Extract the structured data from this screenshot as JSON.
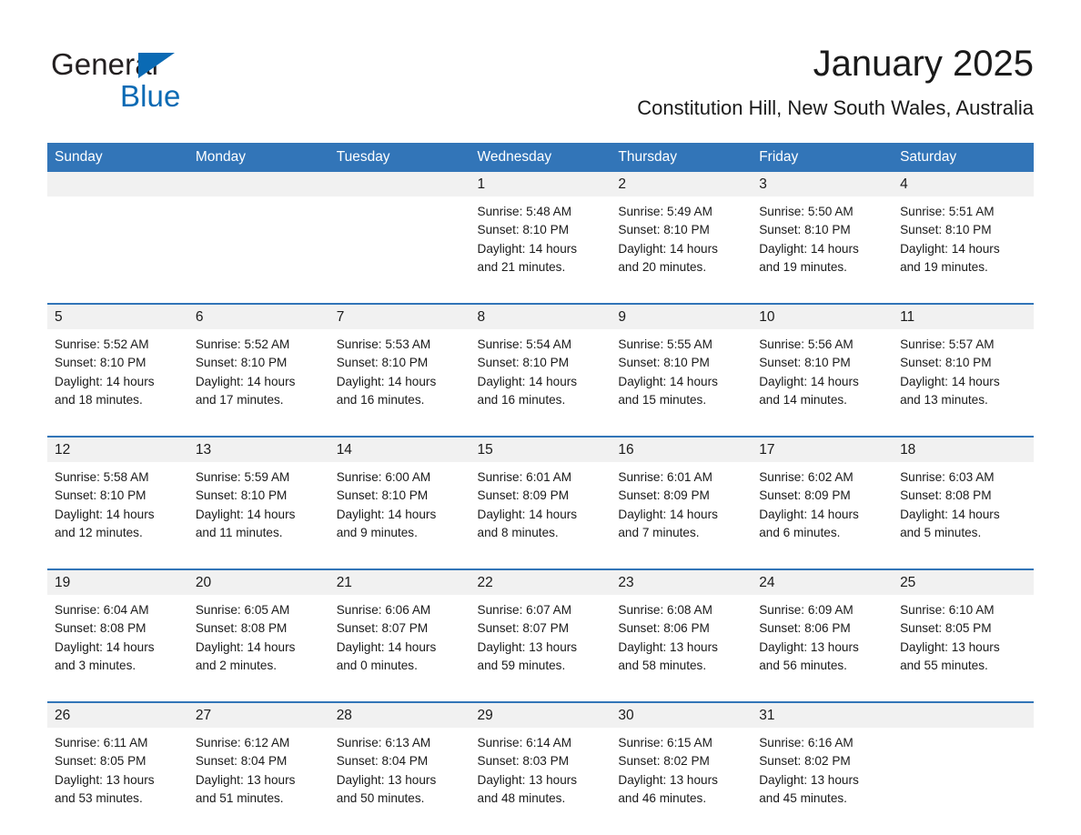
{
  "logo": {
    "text_dark": "General",
    "text_blue": "Blue",
    "triangle_color": "#0a6ab4"
  },
  "header": {
    "title": "January 2025",
    "subtitle": "Constitution Hill, New South Wales, Australia"
  },
  "theme": {
    "header_blue": "#3275b8",
    "row_divider_blue": "#3275b8",
    "daynum_band": "#f1f1f1",
    "text": "#1a1a1a"
  },
  "weekday_headers": [
    "Sunday",
    "Monday",
    "Tuesday",
    "Wednesday",
    "Thursday",
    "Friday",
    "Saturday"
  ],
  "weeks": [
    [
      {
        "day": "",
        "empty": true,
        "sunrise": "",
        "sunset": "",
        "daylight_line1": "",
        "daylight_line2": ""
      },
      {
        "day": "",
        "empty": true,
        "sunrise": "",
        "sunset": "",
        "daylight_line1": "",
        "daylight_line2": ""
      },
      {
        "day": "",
        "empty": true,
        "sunrise": "",
        "sunset": "",
        "daylight_line1": "",
        "daylight_line2": ""
      },
      {
        "day": "1",
        "empty": false,
        "sunrise": "Sunrise: 5:48 AM",
        "sunset": "Sunset: 8:10 PM",
        "daylight_line1": "Daylight: 14 hours",
        "daylight_line2": "and 21 minutes."
      },
      {
        "day": "2",
        "empty": false,
        "sunrise": "Sunrise: 5:49 AM",
        "sunset": "Sunset: 8:10 PM",
        "daylight_line1": "Daylight: 14 hours",
        "daylight_line2": "and 20 minutes."
      },
      {
        "day": "3",
        "empty": false,
        "sunrise": "Sunrise: 5:50 AM",
        "sunset": "Sunset: 8:10 PM",
        "daylight_line1": "Daylight: 14 hours",
        "daylight_line2": "and 19 minutes."
      },
      {
        "day": "4",
        "empty": false,
        "sunrise": "Sunrise: 5:51 AM",
        "sunset": "Sunset: 8:10 PM",
        "daylight_line1": "Daylight: 14 hours",
        "daylight_line2": "and 19 minutes."
      }
    ],
    [
      {
        "day": "5",
        "empty": false,
        "sunrise": "Sunrise: 5:52 AM",
        "sunset": "Sunset: 8:10 PM",
        "daylight_line1": "Daylight: 14 hours",
        "daylight_line2": "and 18 minutes."
      },
      {
        "day": "6",
        "empty": false,
        "sunrise": "Sunrise: 5:52 AM",
        "sunset": "Sunset: 8:10 PM",
        "daylight_line1": "Daylight: 14 hours",
        "daylight_line2": "and 17 minutes."
      },
      {
        "day": "7",
        "empty": false,
        "sunrise": "Sunrise: 5:53 AM",
        "sunset": "Sunset: 8:10 PM",
        "daylight_line1": "Daylight: 14 hours",
        "daylight_line2": "and 16 minutes."
      },
      {
        "day": "8",
        "empty": false,
        "sunrise": "Sunrise: 5:54 AM",
        "sunset": "Sunset: 8:10 PM",
        "daylight_line1": "Daylight: 14 hours",
        "daylight_line2": "and 16 minutes."
      },
      {
        "day": "9",
        "empty": false,
        "sunrise": "Sunrise: 5:55 AM",
        "sunset": "Sunset: 8:10 PM",
        "daylight_line1": "Daylight: 14 hours",
        "daylight_line2": "and 15 minutes."
      },
      {
        "day": "10",
        "empty": false,
        "sunrise": "Sunrise: 5:56 AM",
        "sunset": "Sunset: 8:10 PM",
        "daylight_line1": "Daylight: 14 hours",
        "daylight_line2": "and 14 minutes."
      },
      {
        "day": "11",
        "empty": false,
        "sunrise": "Sunrise: 5:57 AM",
        "sunset": "Sunset: 8:10 PM",
        "daylight_line1": "Daylight: 14 hours",
        "daylight_line2": "and 13 minutes."
      }
    ],
    [
      {
        "day": "12",
        "empty": false,
        "sunrise": "Sunrise: 5:58 AM",
        "sunset": "Sunset: 8:10 PM",
        "daylight_line1": "Daylight: 14 hours",
        "daylight_line2": "and 12 minutes."
      },
      {
        "day": "13",
        "empty": false,
        "sunrise": "Sunrise: 5:59 AM",
        "sunset": "Sunset: 8:10 PM",
        "daylight_line1": "Daylight: 14 hours",
        "daylight_line2": "and 11 minutes."
      },
      {
        "day": "14",
        "empty": false,
        "sunrise": "Sunrise: 6:00 AM",
        "sunset": "Sunset: 8:10 PM",
        "daylight_line1": "Daylight: 14 hours",
        "daylight_line2": "and 9 minutes."
      },
      {
        "day": "15",
        "empty": false,
        "sunrise": "Sunrise: 6:01 AM",
        "sunset": "Sunset: 8:09 PM",
        "daylight_line1": "Daylight: 14 hours",
        "daylight_line2": "and 8 minutes."
      },
      {
        "day": "16",
        "empty": false,
        "sunrise": "Sunrise: 6:01 AM",
        "sunset": "Sunset: 8:09 PM",
        "daylight_line1": "Daylight: 14 hours",
        "daylight_line2": "and 7 minutes."
      },
      {
        "day": "17",
        "empty": false,
        "sunrise": "Sunrise: 6:02 AM",
        "sunset": "Sunset: 8:09 PM",
        "daylight_line1": "Daylight: 14 hours",
        "daylight_line2": "and 6 minutes."
      },
      {
        "day": "18",
        "empty": false,
        "sunrise": "Sunrise: 6:03 AM",
        "sunset": "Sunset: 8:08 PM",
        "daylight_line1": "Daylight: 14 hours",
        "daylight_line2": "and 5 minutes."
      }
    ],
    [
      {
        "day": "19",
        "empty": false,
        "sunrise": "Sunrise: 6:04 AM",
        "sunset": "Sunset: 8:08 PM",
        "daylight_line1": "Daylight: 14 hours",
        "daylight_line2": "and 3 minutes."
      },
      {
        "day": "20",
        "empty": false,
        "sunrise": "Sunrise: 6:05 AM",
        "sunset": "Sunset: 8:08 PM",
        "daylight_line1": "Daylight: 14 hours",
        "daylight_line2": "and 2 minutes."
      },
      {
        "day": "21",
        "empty": false,
        "sunrise": "Sunrise: 6:06 AM",
        "sunset": "Sunset: 8:07 PM",
        "daylight_line1": "Daylight: 14 hours",
        "daylight_line2": "and 0 minutes."
      },
      {
        "day": "22",
        "empty": false,
        "sunrise": "Sunrise: 6:07 AM",
        "sunset": "Sunset: 8:07 PM",
        "daylight_line1": "Daylight: 13 hours",
        "daylight_line2": "and 59 minutes."
      },
      {
        "day": "23",
        "empty": false,
        "sunrise": "Sunrise: 6:08 AM",
        "sunset": "Sunset: 8:06 PM",
        "daylight_line1": "Daylight: 13 hours",
        "daylight_line2": "and 58 minutes."
      },
      {
        "day": "24",
        "empty": false,
        "sunrise": "Sunrise: 6:09 AM",
        "sunset": "Sunset: 8:06 PM",
        "daylight_line1": "Daylight: 13 hours",
        "daylight_line2": "and 56 minutes."
      },
      {
        "day": "25",
        "empty": false,
        "sunrise": "Sunrise: 6:10 AM",
        "sunset": "Sunset: 8:05 PM",
        "daylight_line1": "Daylight: 13 hours",
        "daylight_line2": "and 55 minutes."
      }
    ],
    [
      {
        "day": "26",
        "empty": false,
        "sunrise": "Sunrise: 6:11 AM",
        "sunset": "Sunset: 8:05 PM",
        "daylight_line1": "Daylight: 13 hours",
        "daylight_line2": "and 53 minutes."
      },
      {
        "day": "27",
        "empty": false,
        "sunrise": "Sunrise: 6:12 AM",
        "sunset": "Sunset: 8:04 PM",
        "daylight_line1": "Daylight: 13 hours",
        "daylight_line2": "and 51 minutes."
      },
      {
        "day": "28",
        "empty": false,
        "sunrise": "Sunrise: 6:13 AM",
        "sunset": "Sunset: 8:04 PM",
        "daylight_line1": "Daylight: 13 hours",
        "daylight_line2": "and 50 minutes."
      },
      {
        "day": "29",
        "empty": false,
        "sunrise": "Sunrise: 6:14 AM",
        "sunset": "Sunset: 8:03 PM",
        "daylight_line1": "Daylight: 13 hours",
        "daylight_line2": "and 48 minutes."
      },
      {
        "day": "30",
        "empty": false,
        "sunrise": "Sunrise: 6:15 AM",
        "sunset": "Sunset: 8:02 PM",
        "daylight_line1": "Daylight: 13 hours",
        "daylight_line2": "and 46 minutes."
      },
      {
        "day": "31",
        "empty": false,
        "sunrise": "Sunrise: 6:16 AM",
        "sunset": "Sunset: 8:02 PM",
        "daylight_line1": "Daylight: 13 hours",
        "daylight_line2": "and 45 minutes."
      },
      {
        "day": "",
        "empty": true,
        "sunrise": "",
        "sunset": "",
        "daylight_line1": "",
        "daylight_line2": ""
      }
    ]
  ]
}
